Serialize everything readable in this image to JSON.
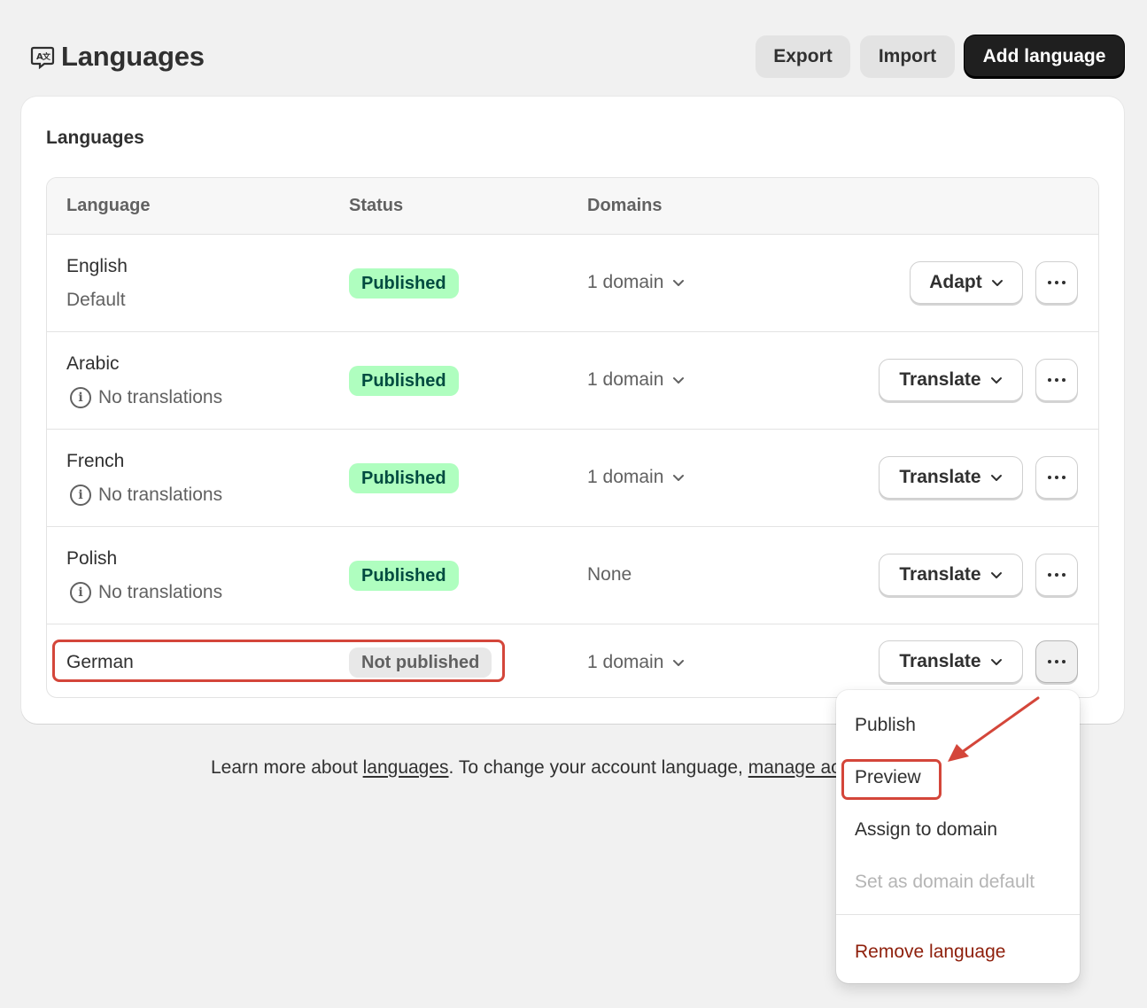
{
  "header": {
    "title": "Languages",
    "icon": "translate-icon",
    "buttons": {
      "export": "Export",
      "import": "Import",
      "add": "Add language"
    }
  },
  "card": {
    "title": "Languages",
    "columns": {
      "language": "Language",
      "status": "Status",
      "domains": "Domains"
    },
    "rows": [
      {
        "name": "English",
        "sub": "Default",
        "status": "Published",
        "domain": "1 domain",
        "action": "Adapt"
      },
      {
        "name": "Arabic",
        "sub": "No translations",
        "status": "Published",
        "domain": "1 domain",
        "action": "Translate"
      },
      {
        "name": "French",
        "sub": "No translations",
        "status": "Published",
        "domain": "1 domain",
        "action": "Translate"
      },
      {
        "name": "Polish",
        "sub": "No translations",
        "status": "Published",
        "domain": "None",
        "action": "Translate"
      },
      {
        "name": "German",
        "sub": "",
        "status": "Not published",
        "domain": "1 domain",
        "action": "Translate"
      }
    ]
  },
  "footer": {
    "prefix": "Learn more about ",
    "link1": "languages",
    "middle": ". To change your account language, ",
    "link2": "manage account"
  },
  "menu": {
    "items": {
      "publish": "Publish",
      "preview": "Preview",
      "assign": "Assign to domain",
      "set_default": "Set as domain default",
      "remove": "Remove language"
    }
  },
  "colors": {
    "published_bg": "#affebf",
    "published_text": "#014b40",
    "annotation": "#d4463a",
    "danger": "#8e1f0b"
  }
}
